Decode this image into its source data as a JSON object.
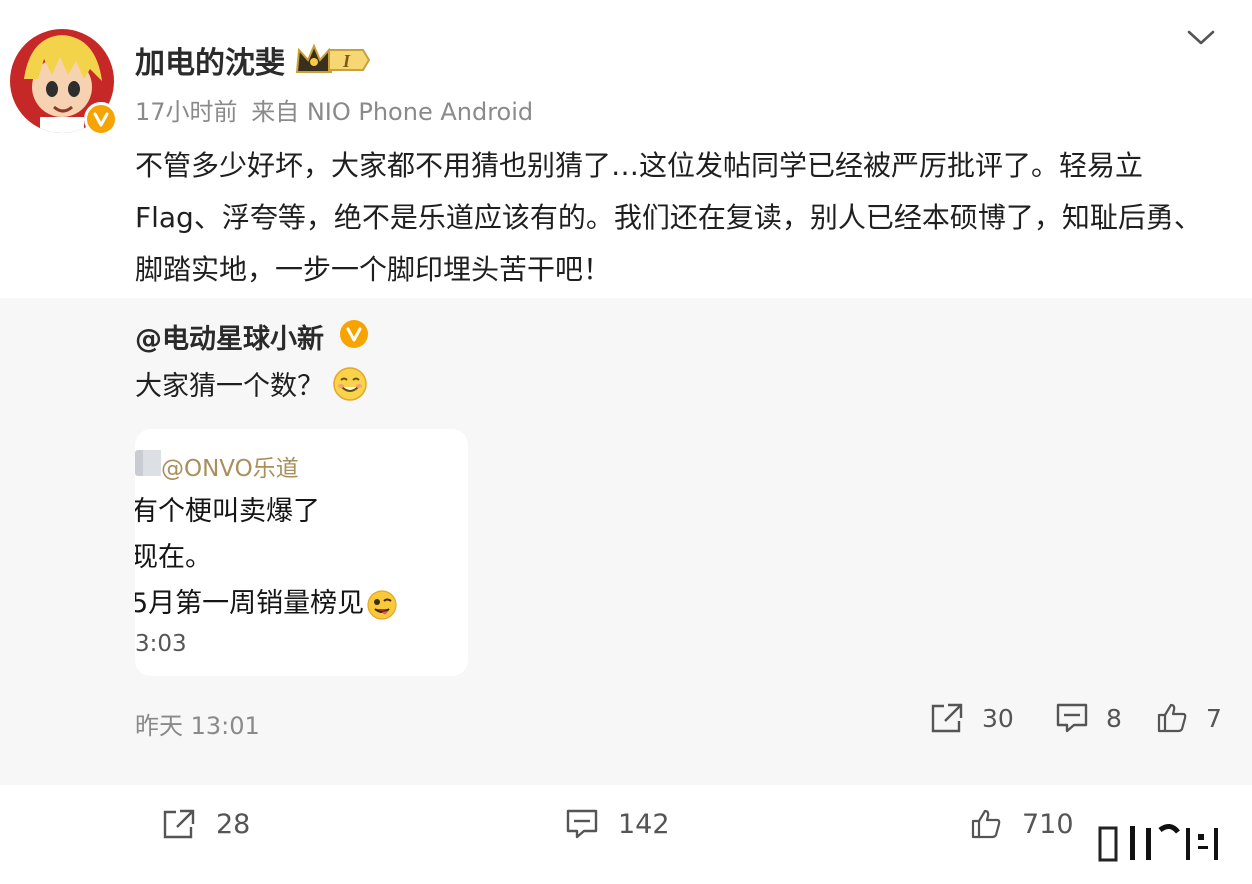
{
  "author": {
    "name": "加电的沈斐",
    "level_badge": "I",
    "time": "17小时前",
    "source": "来自 NIO Phone Android"
  },
  "post": {
    "content": "不管多少好坏，大家都不用猜也别猜了…这位发帖同学已经被严厉批评了。轻易立Flag、浮夸等，绝不是乐道应该有的。我们还在复读，别人已经本硕博了，知耻后勇、脚踏实地，一步一个脚印埋头苦干吧！"
  },
  "repost": {
    "user": "@电动星球小新",
    "text": "大家猜一个数？",
    "screenshot": {
      "mention": "@ONVO乐道",
      "line1": "有个梗叫卖爆了",
      "line2": "现在。",
      "line3": "5月第一周销量榜见",
      "time": "3:03"
    },
    "time": "昨天 13:01",
    "shares": "30",
    "comments": "8",
    "likes": "7"
  },
  "actions": {
    "shares": "28",
    "comments": "142",
    "likes": "710"
  },
  "colors": {
    "verified": "#f7a400",
    "background_quote": "#f7f7f7",
    "meta_text": "#8a8a8a"
  }
}
